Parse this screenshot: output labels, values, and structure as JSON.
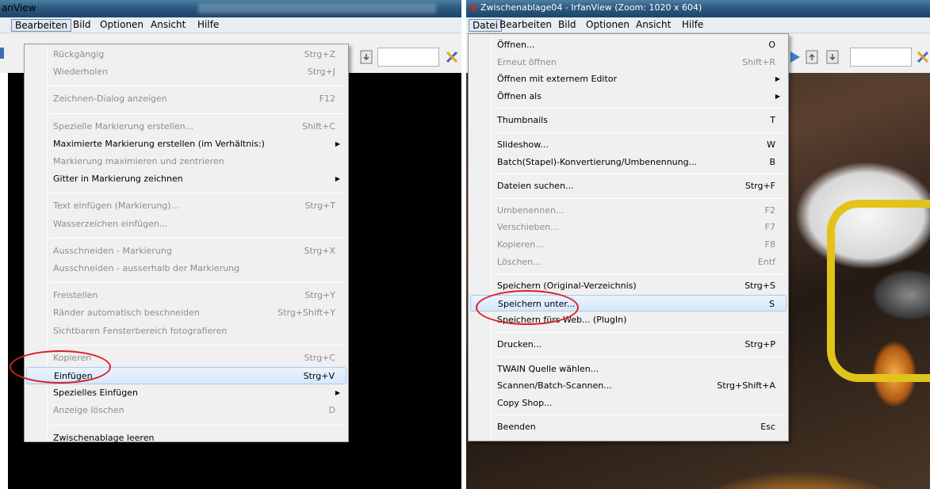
{
  "left_window": {
    "title": "anView",
    "menubar": [
      "Bearbeiten",
      "Bild",
      "Optionen",
      "Ansicht",
      "Hilfe"
    ],
    "menu": [
      {
        "type": "item",
        "label": "Rückgängig",
        "shortcut": "Strg+Z",
        "disabled": true
      },
      {
        "type": "item",
        "label": "Wiederholen",
        "shortcut": "Strg+J",
        "disabled": true
      },
      {
        "type": "sep"
      },
      {
        "type": "item",
        "label": "Zeichnen-Dialog anzeigen",
        "shortcut": "F12",
        "disabled": true
      },
      {
        "type": "sep"
      },
      {
        "type": "item",
        "label": "Spezielle Markierung erstellen...",
        "shortcut": "Shift+C",
        "disabled": true
      },
      {
        "type": "item",
        "label": "Maximierte Markierung erstellen (im Verhältnis:)",
        "shortcut": "",
        "submenu": true
      },
      {
        "type": "item",
        "label": "Markierung maximieren und zentrieren",
        "shortcut": "",
        "disabled": true
      },
      {
        "type": "item",
        "label": "Gitter in Markierung zeichnen",
        "shortcut": "",
        "submenu": true
      },
      {
        "type": "sep"
      },
      {
        "type": "item",
        "label": "Text einfügen (Markierung)...",
        "shortcut": "Strg+T",
        "disabled": true
      },
      {
        "type": "item",
        "label": "Wasserzeichen einfügen...",
        "shortcut": "",
        "disabled": true
      },
      {
        "type": "sep"
      },
      {
        "type": "item",
        "label": "Ausschneiden - Markierung",
        "shortcut": "Strg+X",
        "disabled": true
      },
      {
        "type": "item",
        "label": "Ausschneiden - ausserhalb der Markierung",
        "shortcut": "",
        "disabled": true
      },
      {
        "type": "sep"
      },
      {
        "type": "item",
        "label": "Freistellen",
        "shortcut": "Strg+Y",
        "disabled": true
      },
      {
        "type": "item",
        "label": "Ränder automatisch beschneiden",
        "shortcut": "Strg+Shift+Y",
        "disabled": true
      },
      {
        "type": "item",
        "label": "Sichtbaren Fensterbereich fotografieren",
        "shortcut": "",
        "disabled": true
      },
      {
        "type": "sep"
      },
      {
        "type": "item",
        "label": "Kopieren",
        "shortcut": "Strg+C",
        "disabled": true
      },
      {
        "type": "item",
        "label": "Einfügen",
        "shortcut": "Strg+V",
        "highlight": true
      },
      {
        "type": "item",
        "label": "Spezielles Einfügen",
        "shortcut": "",
        "submenu": true
      },
      {
        "type": "item",
        "label": "Anzeige löschen",
        "shortcut": "D",
        "disabled": true
      },
      {
        "type": "sep"
      },
      {
        "type": "item",
        "label": "Zwischenablage leeren",
        "shortcut": ""
      }
    ]
  },
  "right_window": {
    "title": "Zwischenablage04 - IrfanView (Zoom: 1020 x 604)",
    "menubar": [
      "Datei",
      "Bearbeiten",
      "Bild",
      "Optionen",
      "Ansicht",
      "Hilfe"
    ],
    "menu": [
      {
        "type": "item",
        "label": "Öffnen...",
        "shortcut": "O"
      },
      {
        "type": "item",
        "label": "Erneut öffnen",
        "shortcut": "Shift+R",
        "disabled": true
      },
      {
        "type": "item",
        "label": "Öffnen mit externem Editor",
        "shortcut": "",
        "submenu": true
      },
      {
        "type": "item",
        "label": "Öffnen als",
        "shortcut": "",
        "submenu": true
      },
      {
        "type": "sep"
      },
      {
        "type": "item",
        "label": "Thumbnails",
        "shortcut": "T"
      },
      {
        "type": "sep"
      },
      {
        "type": "item",
        "label": "Slideshow...",
        "shortcut": "W"
      },
      {
        "type": "item",
        "label": "Batch(Stapel)-Konvertierung/Umbenennung...",
        "shortcut": "B"
      },
      {
        "type": "sep"
      },
      {
        "type": "item",
        "label": "Dateien suchen...",
        "shortcut": "Strg+F"
      },
      {
        "type": "sep"
      },
      {
        "type": "item",
        "label": "Umbenennen...",
        "shortcut": "F2",
        "disabled": true
      },
      {
        "type": "item",
        "label": "Verschieben...",
        "shortcut": "F7",
        "disabled": true
      },
      {
        "type": "item",
        "label": "Kopieren...",
        "shortcut": "F8",
        "disabled": true
      },
      {
        "type": "item",
        "label": "Löschen...",
        "shortcut": "Entf",
        "disabled": true
      },
      {
        "type": "sep"
      },
      {
        "type": "item",
        "label": "Speichern (Original-Verzeichnis)",
        "shortcut": "Strg+S"
      },
      {
        "type": "item",
        "label": "Speichern unter...",
        "shortcut": "S",
        "highlight": true
      },
      {
        "type": "item",
        "label": "Speichern fürs Web... (PlugIn)",
        "shortcut": ""
      },
      {
        "type": "sep"
      },
      {
        "type": "item",
        "label": "Drucken...",
        "shortcut": "Strg+P"
      },
      {
        "type": "sep"
      },
      {
        "type": "item",
        "label": "TWAIN Quelle wählen...",
        "shortcut": ""
      },
      {
        "type": "item",
        "label": "Scannen/Batch-Scannen...",
        "shortcut": "Strg+Shift+A"
      },
      {
        "type": "item",
        "label": "Copy Shop...",
        "shortcut": ""
      },
      {
        "type": "sep"
      },
      {
        "type": "item",
        "label": "Beenden",
        "shortcut": "Esc"
      }
    ]
  },
  "colors": {
    "annotation": "#d8202a",
    "highlight": "#d6e8fb",
    "menu_bg": "#f0f0f0",
    "disabled_text": "#8d8d8d"
  }
}
